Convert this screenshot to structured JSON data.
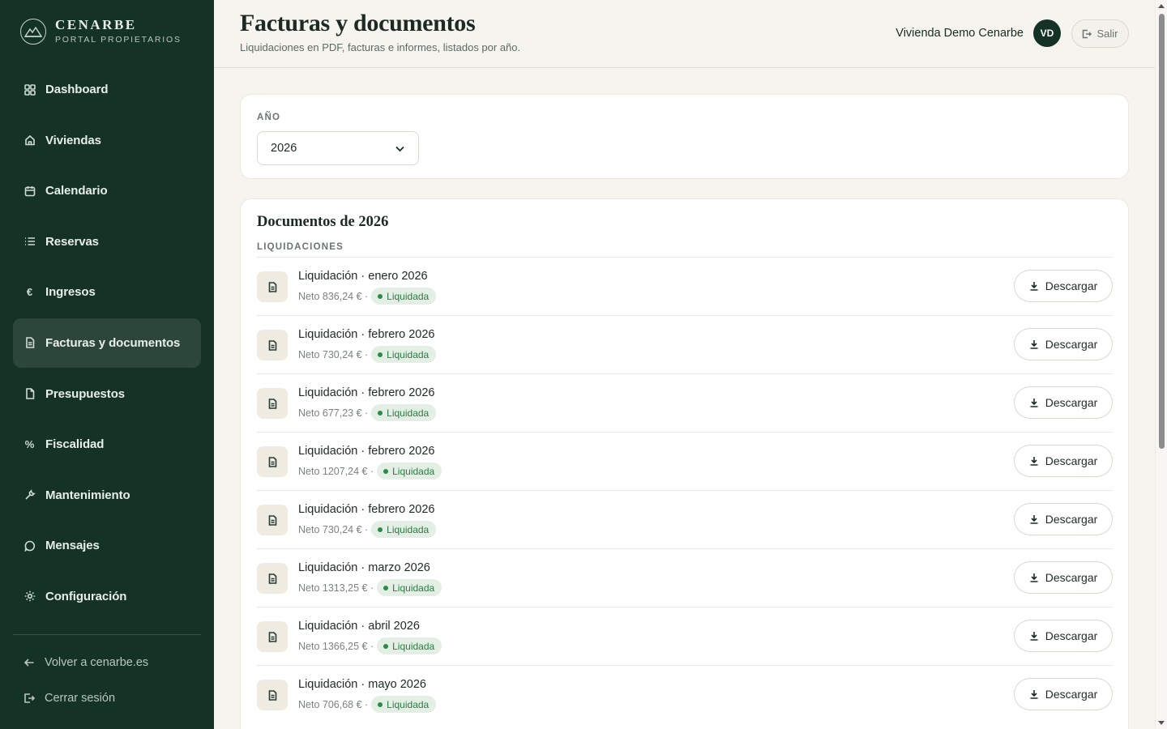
{
  "brand": {
    "name": "CENARBE",
    "subtitle": "PORTAL PROPIETARIOS"
  },
  "sidebar": {
    "items": [
      {
        "label": "Dashboard",
        "icon": "grid-icon"
      },
      {
        "label": "Viviendas",
        "icon": "home-icon"
      },
      {
        "label": "Calendario",
        "icon": "calendar-icon"
      },
      {
        "label": "Reservas",
        "icon": "list-icon"
      },
      {
        "label": "Ingresos",
        "icon": "euro-icon"
      },
      {
        "label": "Facturas y documentos",
        "icon": "document-icon",
        "active": true
      },
      {
        "label": "Presupuestos",
        "icon": "file-icon"
      },
      {
        "label": "Fiscalidad",
        "icon": "percent-icon"
      },
      {
        "label": "Mantenimiento",
        "icon": "wrench-icon"
      },
      {
        "label": "Mensajes",
        "icon": "message-icon"
      },
      {
        "label": "Configuración",
        "icon": "settings-icon"
      }
    ],
    "back_label": "Volver a cenarbe.es",
    "logout_label": "Cerrar sesión"
  },
  "header": {
    "title": "Facturas y documentos",
    "subtitle": "Liquidaciones en PDF, facturas e informes, listados por año.",
    "user_name": "Vivienda Demo Cenarbe",
    "avatar_initials": "VD",
    "logout_label": "Salir"
  },
  "year_filter": {
    "label": "AÑO",
    "selected": "2026"
  },
  "documents": {
    "title": "Documentos de 2026",
    "section_label": "LIQUIDACIONES",
    "download_label": "Descargar",
    "rows": [
      {
        "title": "Liquidación · enero 2026",
        "meta": "Neto 836,24 € ·",
        "status": "Liquidada"
      },
      {
        "title": "Liquidación · febrero 2026",
        "meta": "Neto 730,24 € ·",
        "status": "Liquidada"
      },
      {
        "title": "Liquidación · febrero 2026",
        "meta": "Neto 677,23 € ·",
        "status": "Liquidada"
      },
      {
        "title": "Liquidación · febrero 2026",
        "meta": "Neto 1207,24 € ·",
        "status": "Liquidada"
      },
      {
        "title": "Liquidación · febrero 2026",
        "meta": "Neto 730,24 € ·",
        "status": "Liquidada"
      },
      {
        "title": "Liquidación · marzo 2026",
        "meta": "Neto 1313,25 € ·",
        "status": "Liquidada"
      },
      {
        "title": "Liquidación · abril 2026",
        "meta": "Neto 1366,25 € ·",
        "status": "Liquidada"
      },
      {
        "title": "Liquidación · mayo 2026",
        "meta": "Neto 706,68 € ·",
        "status": "Liquidada"
      }
    ]
  },
  "colors": {
    "sidebar_bg": "#143226",
    "accent_green": "#2c7a43",
    "badge_bg": "#e3efe5"
  }
}
